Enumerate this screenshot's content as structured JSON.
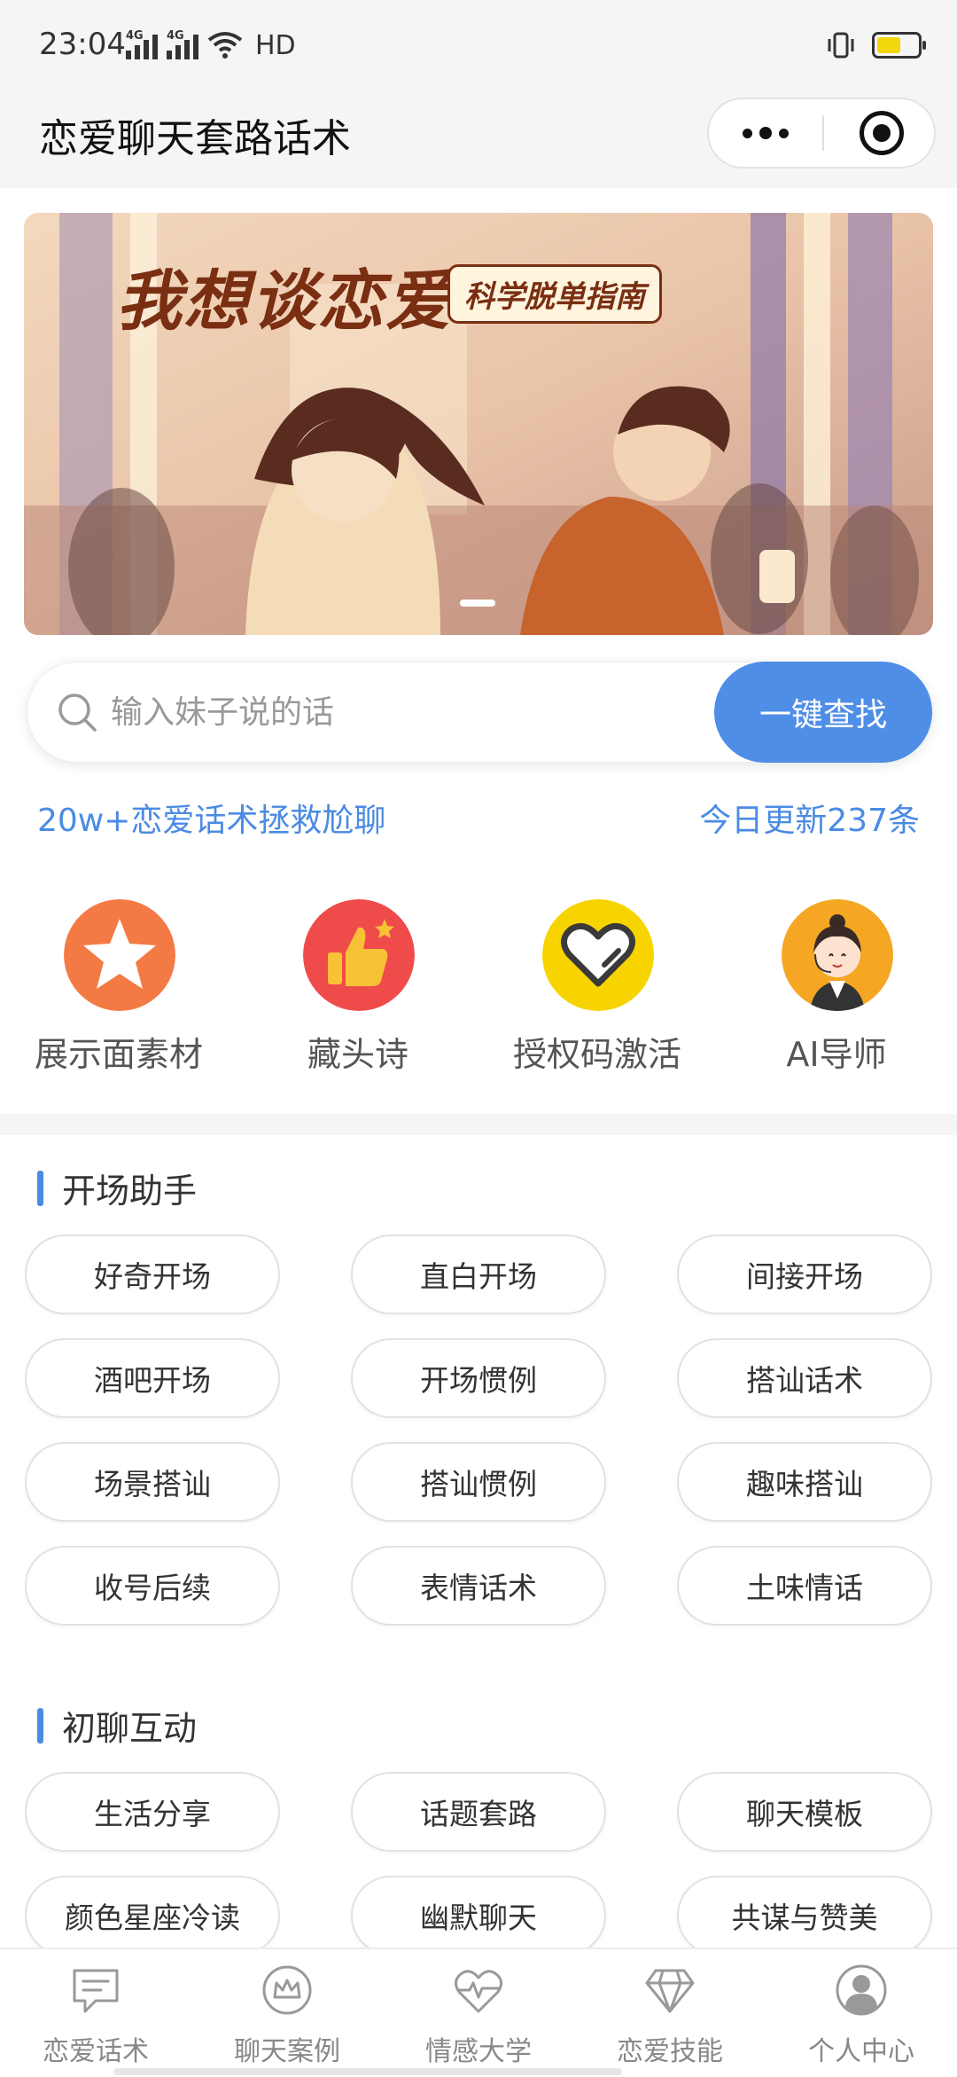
{
  "status_bar": {
    "time": "23:04",
    "network_1": "4G",
    "network_2": "4G",
    "hd_label": "HD",
    "battery_level": 0.6,
    "battery_color": "#f2d70f"
  },
  "nav": {
    "title": "恋爱聊天套路话术",
    "more_icon": "more-dots-icon",
    "close_icon": "target-close-icon"
  },
  "banner": {
    "headline": "我想谈恋爱",
    "subtitle": "科学脱单指南",
    "slide_index": 1,
    "slide_count": 1
  },
  "search": {
    "placeholder": "输入妹子说的话",
    "value": "",
    "button_label": "一键查找",
    "accent_color": "#4f8ee7"
  },
  "tagline": {
    "left": "20w+恋爱话术拯救尬聊",
    "right": "今日更新237条"
  },
  "quick_actions": [
    {
      "label": "展示面素材",
      "icon": "star-icon",
      "color": "#f47a45"
    },
    {
      "label": "藏头诗",
      "icon": "thumbs-up-icon",
      "color": "#f04b4b"
    },
    {
      "label": "授权码激活",
      "icon": "heart-icon",
      "color": "#f7d400"
    },
    {
      "label": "AI导师",
      "icon": "assistant-avatar-icon",
      "color": "#f5a623"
    }
  ],
  "sections": [
    {
      "title": "开场助手",
      "items": [
        "好奇开场",
        "直白开场",
        "间接开场",
        "酒吧开场",
        "开场惯例",
        "搭讪话术",
        "场景搭讪",
        "搭讪惯例",
        "趣味搭讪",
        "收号后续",
        "表情话术",
        "土味情话"
      ]
    },
    {
      "title": "初聊互动",
      "items": [
        "生活分享",
        "话题套路",
        "聊天模板",
        "颜色星座冷读",
        "幽默聊天",
        "共谋与赞美"
      ]
    }
  ],
  "tabbar": [
    {
      "label": "恋爱话术",
      "icon": "chat-bubble-icon"
    },
    {
      "label": "聊天案例",
      "icon": "crown-icon"
    },
    {
      "label": "情感大学",
      "icon": "heartbeat-icon"
    },
    {
      "label": "恋爱技能",
      "icon": "diamond-icon"
    },
    {
      "label": "个人中心",
      "icon": "user-icon"
    }
  ],
  "colors": {
    "accent": "#4a8be3",
    "background": "#ffffff",
    "page_gray": "#f5f5f5"
  }
}
